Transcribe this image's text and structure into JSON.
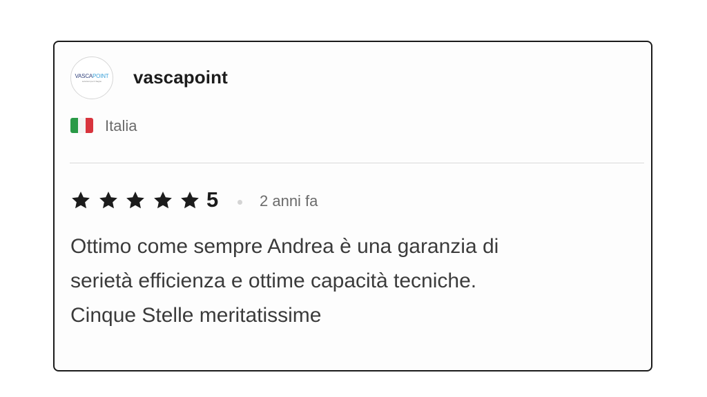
{
  "reviewer": {
    "logo_text_dark": "VASCA",
    "logo_text_light": "POINT",
    "logo_tagline": "soluzioni per il bagno",
    "name": "vascapoint",
    "country": "Italia",
    "flag_colors": [
      "#2a9a47",
      "#f4f4f4",
      "#d8343d"
    ]
  },
  "review": {
    "stars_filled": 5,
    "stars_total": 5,
    "rating_label": "5",
    "separator": "•",
    "time_ago": "2 anni fa",
    "text_lines": [
      "Ottimo come sempre Andrea è una garanzia di",
      "serietà efficienza e ottime capacità tecniche.",
      "Cinque Stelle meritatissime"
    ]
  },
  "colors": {
    "border": "#1a1a1a",
    "star": "#1c1c1c",
    "muted_text": "#6b6b6b"
  }
}
